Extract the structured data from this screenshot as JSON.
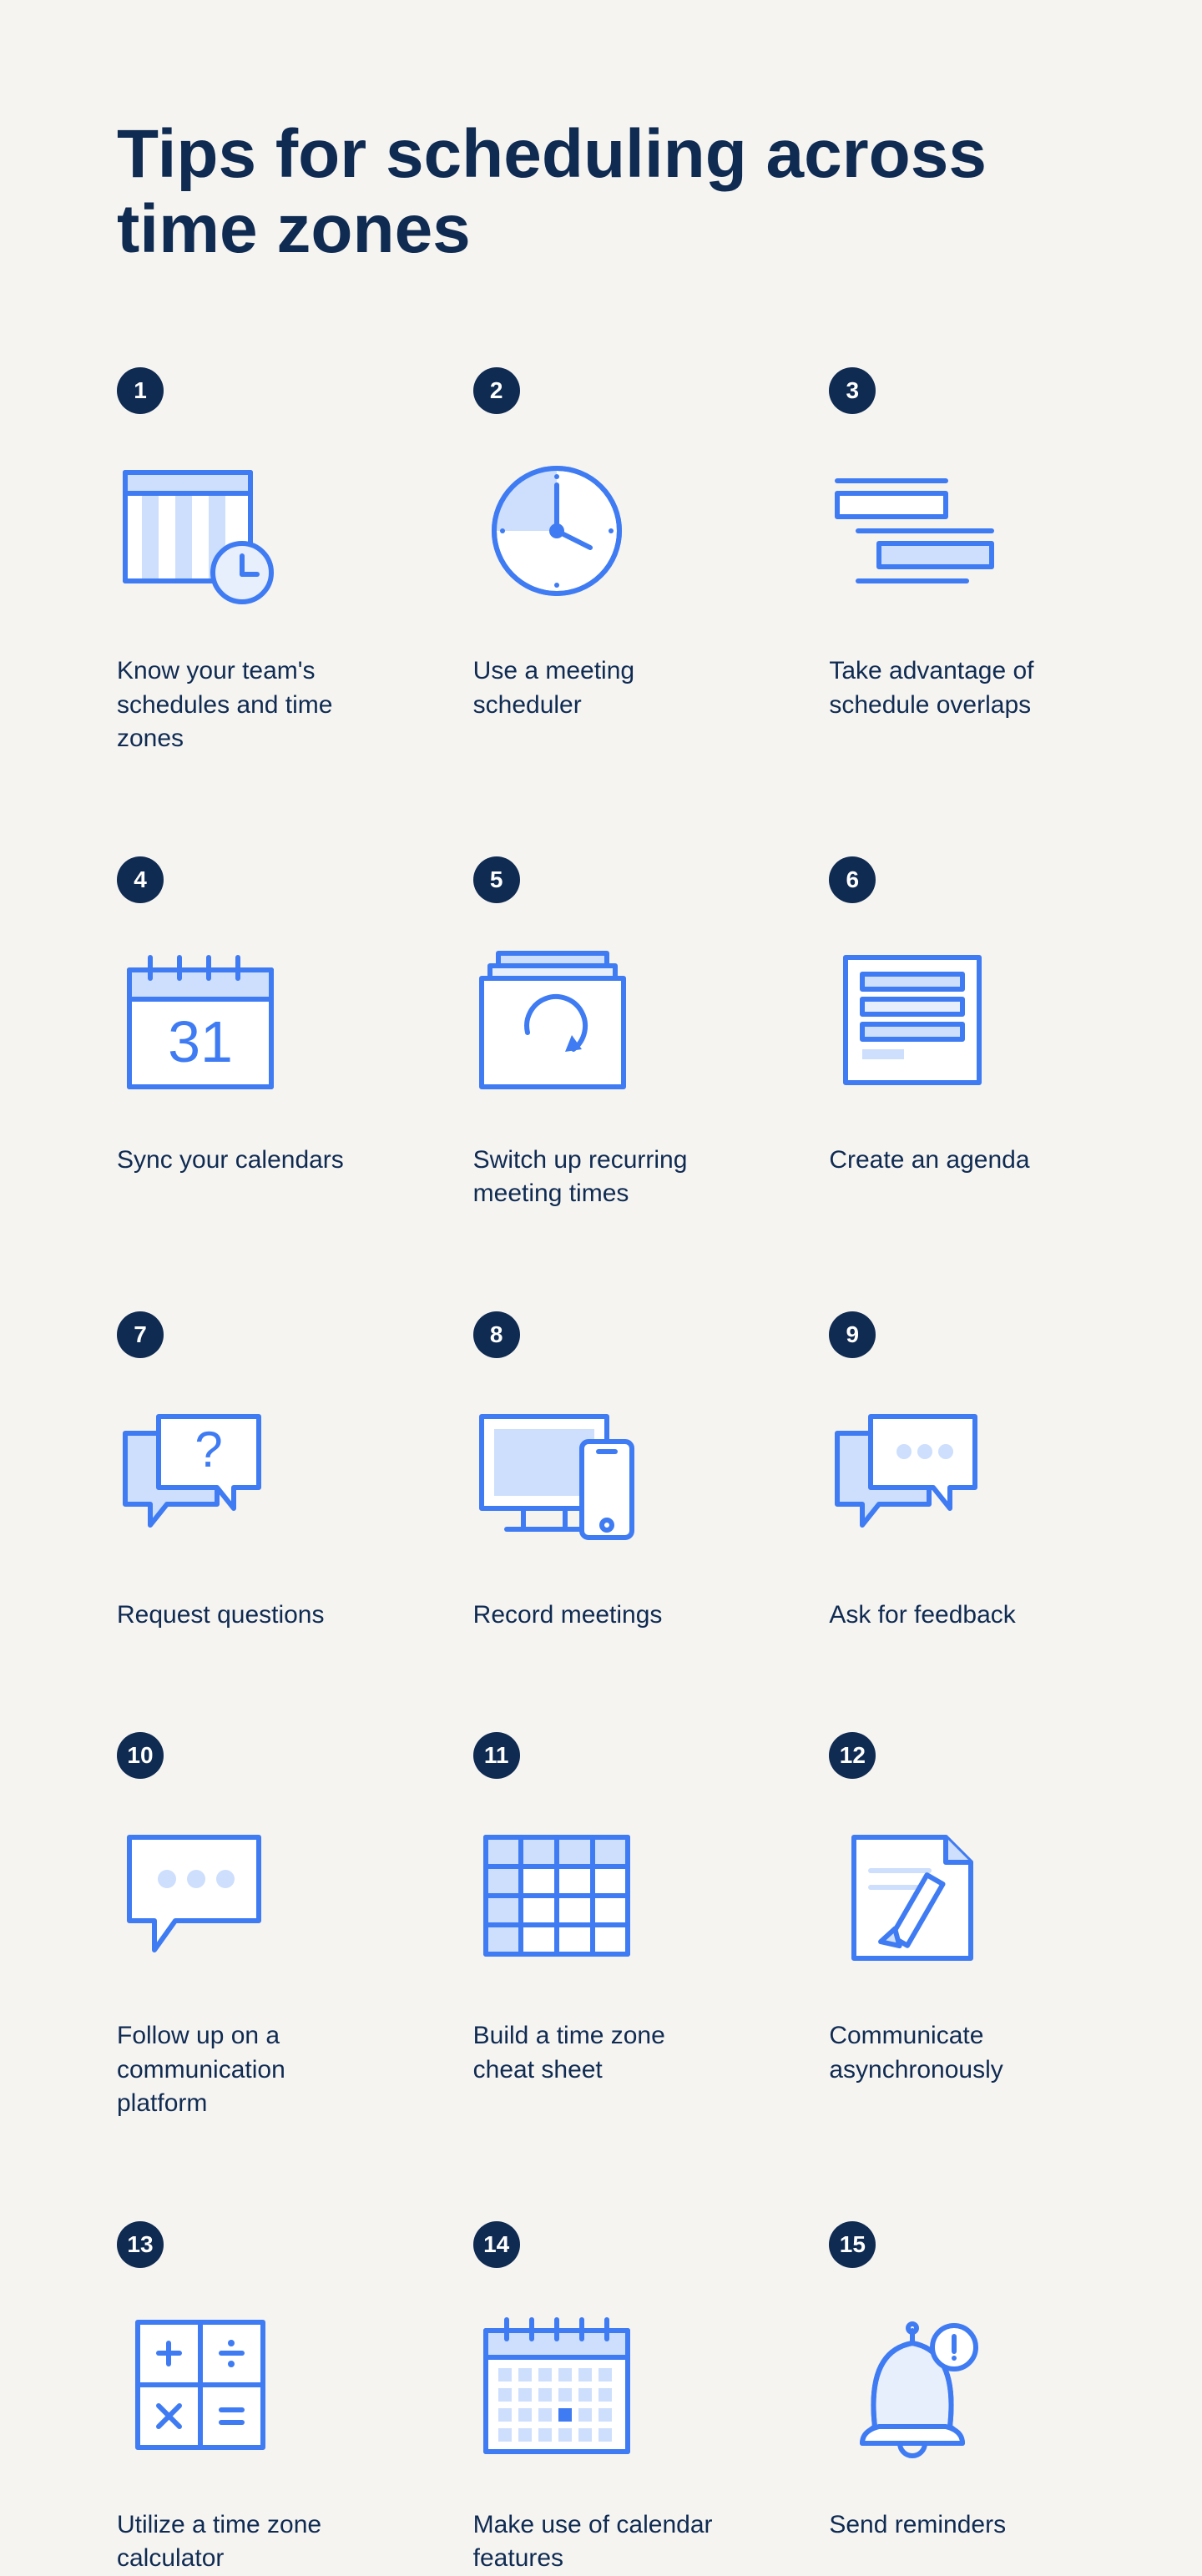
{
  "title": "Tips for scheduling across time zones",
  "colors": {
    "bg": "#f6f4f1",
    "navy": "#0f2b52",
    "stroke": "#3f7bf2",
    "pale": "#cddffc",
    "pale2": "#e7eefc"
  },
  "tips": [
    {
      "n": "1",
      "label": "Know your team's schedules and time zones",
      "icon": "calendar-clock"
    },
    {
      "n": "2",
      "label": "Use a meeting scheduler",
      "icon": "clock"
    },
    {
      "n": "3",
      "label": "Take advantage of schedule overlaps",
      "icon": "overlap-bars"
    },
    {
      "n": "4",
      "label": "Sync your calendars",
      "icon": "calendar-31"
    },
    {
      "n": "5",
      "label": "Switch up recurring meeting times",
      "icon": "recurring"
    },
    {
      "n": "6",
      "label": "Create an agenda",
      "icon": "agenda"
    },
    {
      "n": "7",
      "label": "Request questions",
      "icon": "question-bubbles"
    },
    {
      "n": "8",
      "label": "Record meetings",
      "icon": "devices"
    },
    {
      "n": "9",
      "label": "Ask for feedback",
      "icon": "dots-bubbles"
    },
    {
      "n": "10",
      "label": "Follow up on a communication platform",
      "icon": "dots-bubble-single"
    },
    {
      "n": "11",
      "label": "Build a time zone cheat sheet",
      "icon": "table"
    },
    {
      "n": "12",
      "label": "Communicate asynchronously",
      "icon": "pencil-doc"
    },
    {
      "n": "13",
      "label": "Utilize a time zone calculator",
      "icon": "calculator"
    },
    {
      "n": "14",
      "label": "Make use of calendar features",
      "icon": "calendar-month"
    },
    {
      "n": "15",
      "label": "Send reminders",
      "icon": "bell-alert"
    }
  ]
}
